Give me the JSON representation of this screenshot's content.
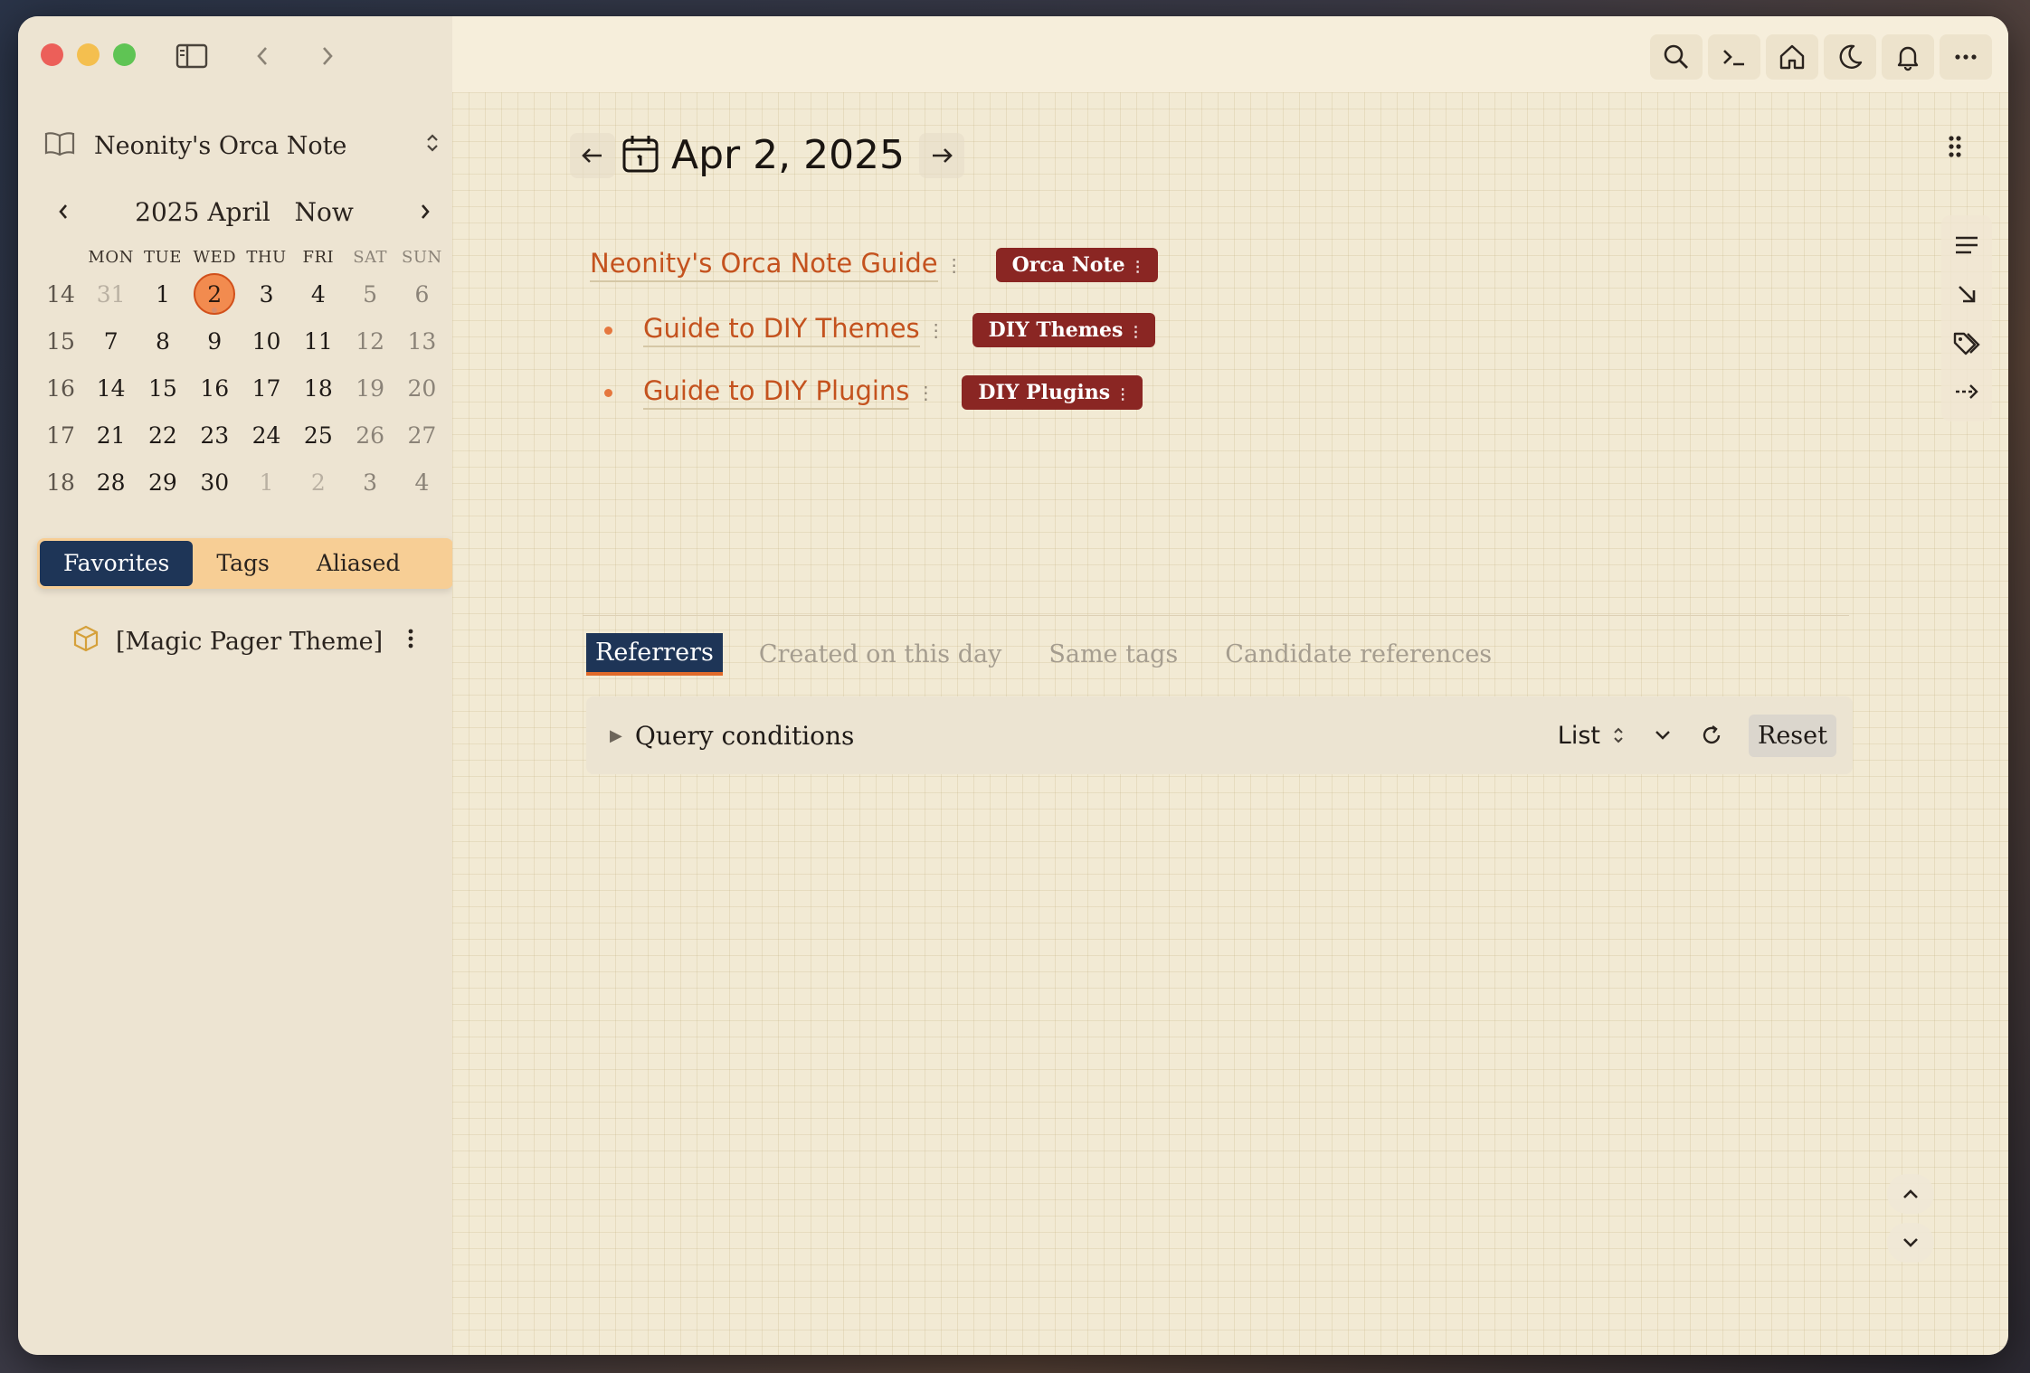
{
  "sidebar": {
    "workspace_name": "Neonity's Orca Note",
    "calendar": {
      "title": "2025 April",
      "now_label": "Now",
      "weekdays": [
        "MON",
        "TUE",
        "WED",
        "THU",
        "FRI",
        "SAT",
        "SUN"
      ],
      "weeks": [
        {
          "wk": "14",
          "days": [
            [
              "31",
              "muted"
            ],
            [
              "1",
              ""
            ],
            [
              "2",
              "today"
            ],
            [
              "3",
              ""
            ],
            [
              "4",
              ""
            ],
            [
              "5",
              "weekend"
            ],
            [
              "6",
              "weekend"
            ]
          ]
        },
        {
          "wk": "15",
          "days": [
            [
              "7",
              ""
            ],
            [
              "8",
              ""
            ],
            [
              "9",
              ""
            ],
            [
              "10",
              ""
            ],
            [
              "11",
              ""
            ],
            [
              "12",
              "weekend"
            ],
            [
              "13",
              "weekend"
            ]
          ]
        },
        {
          "wk": "16",
          "days": [
            [
              "14",
              ""
            ],
            [
              "15",
              ""
            ],
            [
              "16",
              ""
            ],
            [
              "17",
              ""
            ],
            [
              "18",
              ""
            ],
            [
              "19",
              "weekend"
            ],
            [
              "20",
              "weekend"
            ]
          ]
        },
        {
          "wk": "17",
          "days": [
            [
              "21",
              ""
            ],
            [
              "22",
              ""
            ],
            [
              "23",
              ""
            ],
            [
              "24",
              ""
            ],
            [
              "25",
              ""
            ],
            [
              "26",
              "weekend"
            ],
            [
              "27",
              "weekend"
            ]
          ]
        },
        {
          "wk": "18",
          "days": [
            [
              "28",
              ""
            ],
            [
              "29",
              ""
            ],
            [
              "30",
              ""
            ],
            [
              "1",
              "muted"
            ],
            [
              "2",
              "muted"
            ],
            [
              "3",
              "weekend"
            ],
            [
              "4",
              "weekend"
            ]
          ]
        }
      ]
    },
    "tabs": {
      "favorites": "Favorites",
      "tags": "Tags",
      "aliased": "Aliased"
    },
    "favorites": [
      {
        "label": "[Magic Pager Theme]",
        "icon": "cube-icon"
      }
    ]
  },
  "main": {
    "journal_date": "Apr 2, 2025",
    "blocks": [
      {
        "link": "Neonity's Orca Note Guide",
        "tag": "Orca Note"
      },
      {
        "link": "Guide to DIY Themes",
        "tag": "DIY Themes"
      },
      {
        "link": "Guide to DIY Plugins",
        "tag": "DIY Plugins"
      }
    ],
    "ref_tabs": {
      "referrers": "Referrers",
      "created": "Created on this day",
      "same_tags": "Same tags",
      "candidates": "Candidate references"
    },
    "query": {
      "label": "Query conditions",
      "view": "List",
      "reset": "Reset"
    }
  },
  "colors": {
    "accent": "#c4521e",
    "tag_bg": "#8a2623",
    "active_tab": "#1e3557",
    "today": "#f28b4f"
  }
}
